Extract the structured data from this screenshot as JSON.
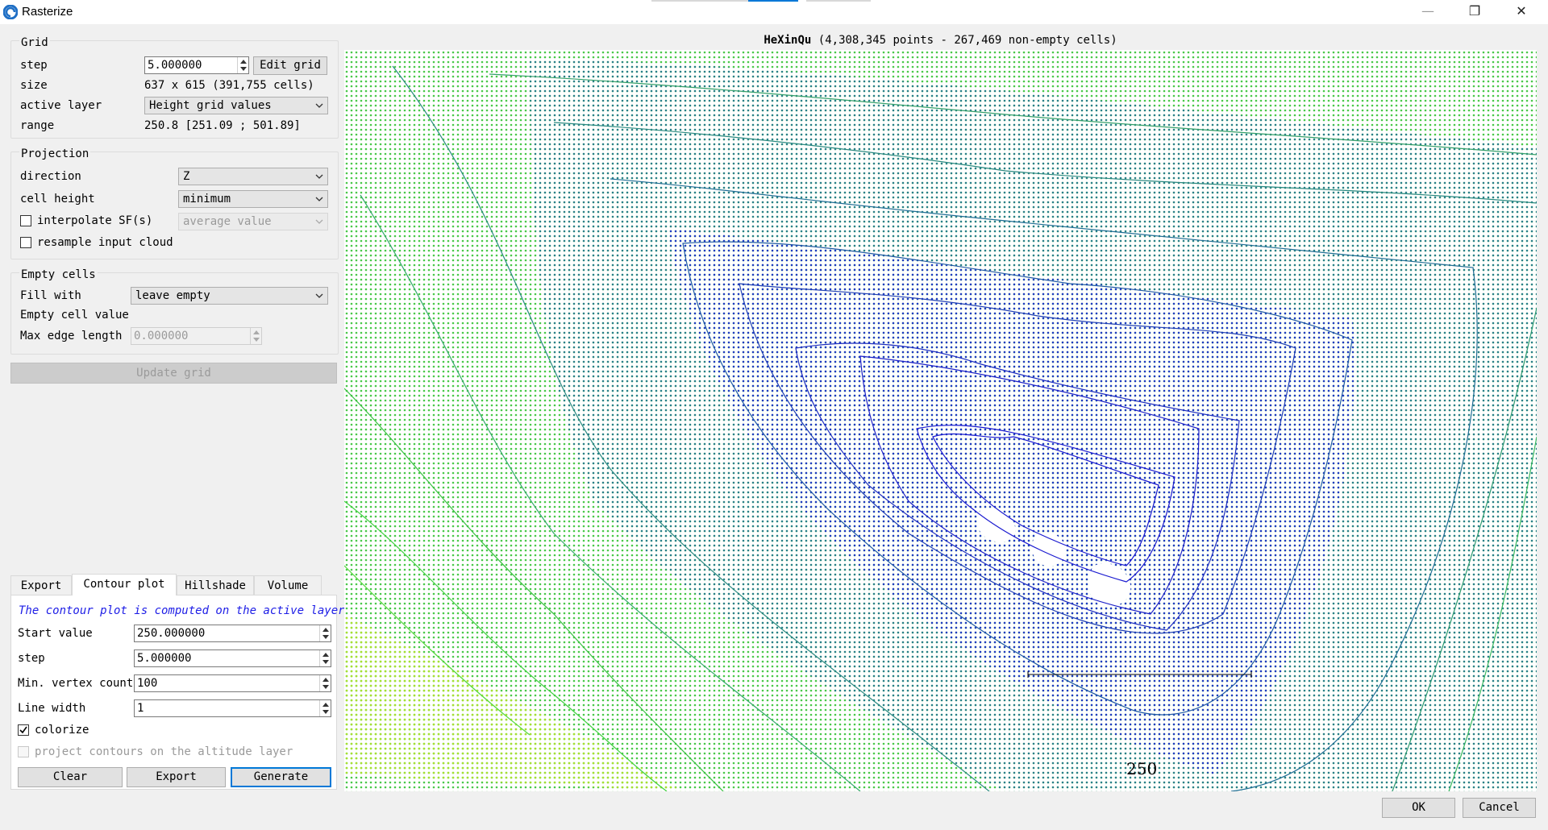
{
  "window": {
    "title": "Rasterize",
    "minimize_glyph": "—",
    "restore_glyph": "❐",
    "close_glyph": "✕"
  },
  "grid": {
    "title": "Grid",
    "step_label": "step",
    "step_value": "5.000000",
    "edit_grid_label": "Edit grid",
    "size_label": "size",
    "size_value": "637 x 615 (391,755 cells)",
    "active_layer_label": "active layer",
    "active_layer_value": "Height grid values",
    "range_label": "range",
    "range_value": "250.8 [251.09 ; 501.89]"
  },
  "projection": {
    "title": "Projection",
    "direction_label": "direction",
    "direction_value": "Z",
    "cell_height_label": "cell height",
    "cell_height_value": "minimum",
    "interpolate_label": "interpolate SF(s)",
    "interpolate_checked": false,
    "interpolate_value": "average value",
    "resample_label": "resample input cloud",
    "resample_checked": false
  },
  "empty_cells": {
    "title": "Empty cells",
    "fill_with_label": "Fill with",
    "fill_with_value": "leave empty",
    "empty_cell_value_label": "Empty cell value",
    "max_edge_length_label": "Max edge length",
    "max_edge_length_value": "0.000000"
  },
  "update_grid_label": "Update grid",
  "tabs": [
    {
      "label": "Export",
      "active": false
    },
    {
      "label": "Contour plot",
      "active": true
    },
    {
      "label": "Hillshade",
      "active": false
    },
    {
      "label": "Volume",
      "active": false
    }
  ],
  "contour": {
    "note": "The contour plot is computed on the active layer",
    "start_value_label": "Start value",
    "start_value": "250.000000",
    "step_label": "step",
    "step_value": "5.000000",
    "min_vertex_label": "Min. vertex count",
    "min_vertex_value": "100",
    "line_width_label": "Line width",
    "line_width_value": "1",
    "colorize_label": "colorize",
    "colorize_checked": true,
    "project_label": "project contours on the altitude layer",
    "project_checked": false,
    "clear_label": "Clear",
    "export_label": "Export",
    "generate_label": "Generate"
  },
  "plot": {
    "cloud_name": "HeXinQu",
    "cloud_info": "(4,308,345 points - 267,469 non-empty cells)",
    "scale_label": "250"
  },
  "footer": {
    "ok_label": "OK",
    "cancel_label": "Cancel"
  },
  "colors": {
    "accent": "#0078d7",
    "note_text": "#1d1de6",
    "contour_high": "#1a1ad0",
    "contour_mid": "#1a6a9a",
    "contour_low": "#38d838"
  },
  "icons": {
    "app": "cloudcompare-logo",
    "combo": "chevron-down",
    "spin": "spin-up-down",
    "check": "checkmark"
  }
}
